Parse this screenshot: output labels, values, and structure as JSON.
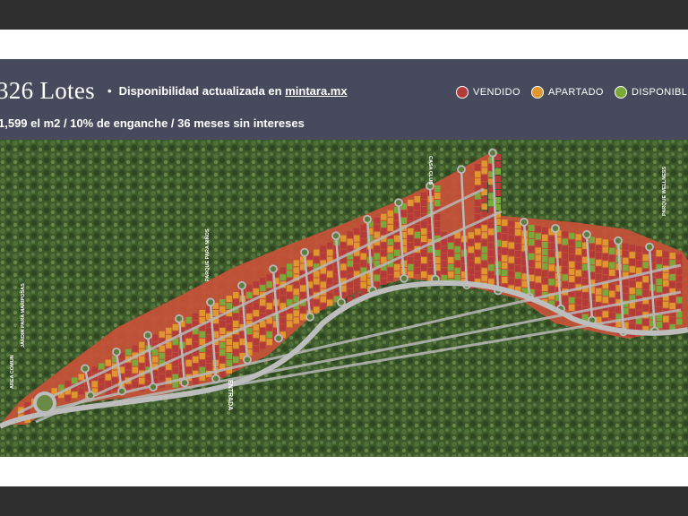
{
  "header": {
    "title": "326 Lotes",
    "availability_prefix": "Disponibilidad actualizada en",
    "availability_link": "mintara.mx",
    "price_line": "1,599 el m2 / 10% de enganche / 36 meses sin intereses"
  },
  "legend": [
    {
      "label": "VENDIDO",
      "color": "#b53a3a"
    },
    {
      "label": "APARTADO",
      "color": "#e0962f"
    },
    {
      "label": "DISPONIBLE",
      "color": "#7aa83a"
    }
  ],
  "map": {
    "poi": {
      "casa_club": "CASA CLUB",
      "parque_wellness": "PARQUE WELLNESS",
      "jardin_para_mariposas": "JARDIN PARA MARIPOSAS",
      "parque_para_ninos": "PARQUE PARA NIÑOS",
      "entrada": "ENTRADA",
      "area_comun": "AREA COMUN"
    },
    "colors": {
      "vendido": "#b53a3a",
      "apartado": "#e0962f",
      "disponible": "#7aa83a",
      "road": "#b9b9b9",
      "forest_dark": "#2f4a22",
      "forest_light": "#4d6a34"
    }
  }
}
